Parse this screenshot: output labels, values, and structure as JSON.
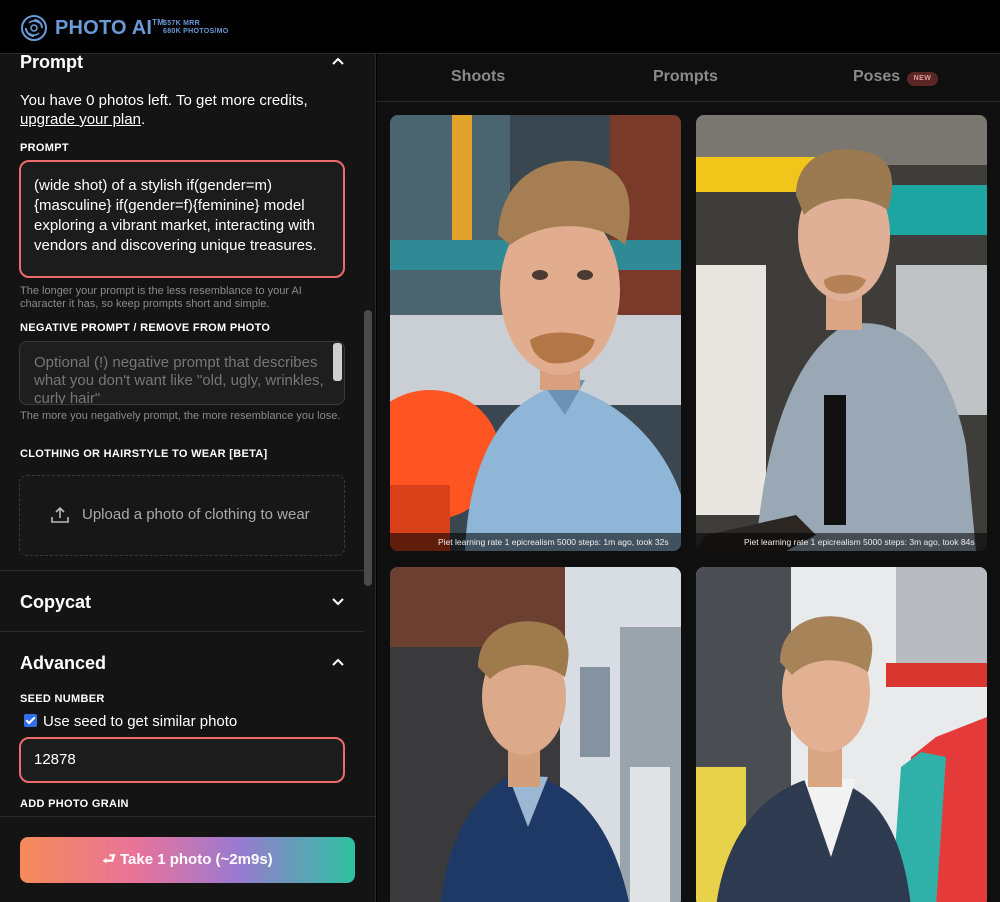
{
  "brand": {
    "name": "PHOTO AI",
    "tm": "TM",
    "stats": [
      "$57K MRR",
      "680K PHOTOS/MO"
    ]
  },
  "prompt_section": {
    "title": "Prompt",
    "credits_text": "You have 0 photos left. To get more credits,",
    "upgrade_link": "upgrade your plan",
    "prompt_label": "PROMPT",
    "prompt_value": "(wide shot) of a stylish if(gender=m){masculine} if(gender=f){feminine} model exploring a vibrant market, interacting with vendors and discovering unique treasures.",
    "prompt_hint": "The longer your prompt is the less resemblance to your AI character it has, so keep prompts short and simple.",
    "negative_label": "NEGATIVE PROMPT / REMOVE FROM PHOTO",
    "negative_placeholder": "Optional (!) negative prompt that describes what you don't want like \"old, ugly, wrinkles, curly hair\"",
    "negative_hint": "The more you negatively prompt, the more resemblance you lose.",
    "clothing_label": "CLOTHING OR HAIRSTYLE TO WEAR [BETA]",
    "upload_text": "Upload a photo of clothing to wear"
  },
  "copycat": {
    "title": "Copycat"
  },
  "advanced": {
    "title": "Advanced",
    "seed_label": "SEED NUMBER",
    "seed_checkbox_label": "Use seed to get similar photo",
    "seed_checked": true,
    "seed_value": "12878",
    "grain_label": "ADD PHOTO GRAIN"
  },
  "take_button": "⮐ Take 1 photo (~2m9s)",
  "tabs": [
    {
      "label": "Shoots"
    },
    {
      "label": "Prompts"
    },
    {
      "label": "Poses",
      "badge": "NEW"
    }
  ],
  "photos": [
    {
      "caption": "Piet learning rate 1 epicrealism 5000 steps: 1m ago, took 32s"
    },
    {
      "caption": "Piet learning rate 1 epicrealism 5000 steps: 3m ago, took 84s"
    },
    {
      "caption": ""
    },
    {
      "caption": ""
    }
  ],
  "colors": {
    "accent_red": "#ef6a6a",
    "brand_blue": "#6a9ad8",
    "checkbox_blue": "#2f6fea"
  }
}
